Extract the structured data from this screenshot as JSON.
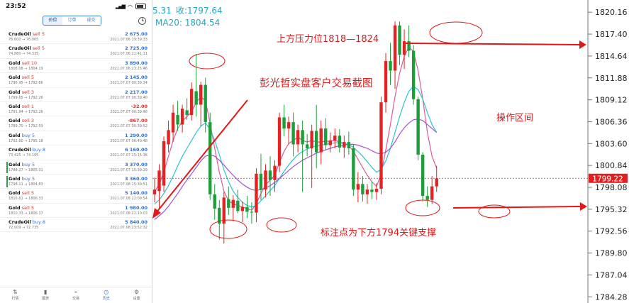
{
  "phone": {
    "status_time": "23:52",
    "tabs": [
      "价位",
      "订单",
      "成交"
    ],
    "active_tab": 0,
    "trades": [
      {
        "symbol": "CrudeOil",
        "side": "sell",
        "lots": "5",
        "profit": "2 675.00",
        "prices": "76.600 → 76.065",
        "time": "2021.07.06 19:39:33"
      },
      {
        "symbol": "CrudeOil",
        "side": "sell",
        "lots": "5",
        "profit": "2 725.00",
        "prices": "74.880 → 74.335",
        "time": "2021.07.06 21:41:11"
      },
      {
        "symbol": "Gold",
        "side": "sell",
        "lots": "10",
        "profit": "3 890.00",
        "prices": "1808.08 → 1804.19",
        "time": "2021.07.06 23:25:46"
      },
      {
        "symbol": "Gold",
        "side": "sell",
        "lots": "5",
        "profit": "2 145.00",
        "prices": "1796.95 → 1792.66",
        "time": "2021.07.07 00:39:34"
      },
      {
        "symbol": "Gold",
        "side": "sell",
        "lots": "3",
        "profit": "2 217.00",
        "prices": "1799.65 → 1792.26",
        "time": "2021.07.07 00:39:40"
      },
      {
        "symbol": "Gold",
        "side": "sell",
        "lots": "1",
        "profit": "-32.00",
        "prices": "1791.94 → 1792.26",
        "time": "2021.07.07 00:39:46"
      },
      {
        "symbol": "Gold",
        "side": "sell",
        "lots": "3",
        "profit": "-867.00",
        "prices": "1789.70 → 1792.59",
        "time": "2021.07.07 00:39:52"
      },
      {
        "symbol": "Gold",
        "side": "buy",
        "lots": "5",
        "profit": "1 290.00",
        "prices": "1792.60 → 1795.18",
        "time": "2021.07.07 06:40:48"
      },
      {
        "symbol": "CrudeOil",
        "side": "buy",
        "lots": "8",
        "profit": "6 160.00",
        "prices": "73.425 → 74.195",
        "time": "2021.07.07 15:15:36"
      },
      {
        "symbol": "Gold",
        "side": "buy",
        "lots": "5",
        "profit": "3 370.00",
        "prices": "1798.27 → 1805.01",
        "time": "2021.07.07 15:39:29"
      },
      {
        "symbol": "Gold",
        "side": "buy",
        "lots": "5",
        "profit": "3 360.00",
        "prices": "1798.11 → 1804.83",
        "time": "2021.07.08 15:30:51"
      },
      {
        "symbol": "Gold",
        "side": "sell",
        "lots": "5",
        "profit": "5 140.00",
        "prices": "1816.61 → 1806.33",
        "time": "2021.07.08 22:09:54"
      },
      {
        "symbol": "Gold",
        "side": "sell",
        "lots": "5",
        "profit": "1 980.00",
        "prices": "1810.33 → 1806.37",
        "time": "2021.07.08 22:10:03"
      },
      {
        "symbol": "CrudeOil",
        "side": "buy",
        "lots": "8",
        "profit": "5 840.00",
        "prices": "72.009 → 72.735",
        "time": "2021.07.08 23:52:32"
      }
    ],
    "nav": [
      "行情",
      "图表",
      "交易",
      "历史",
      "设置"
    ],
    "active_nav": 3
  },
  "header": {
    "close_prefix": "5.31",
    "close_label": "收:1797.64",
    "ma20_label": "MA20: 1804.54"
  },
  "annotations": {
    "watermark": "彭光哲实盘客户交易截图",
    "resistance": "上方压力位1818—1824",
    "operate": "操作区间",
    "support": "标注点为下方1794关键支撑"
  },
  "current_price": "1799.22",
  "colors": {
    "up": "#e32222",
    "down": "#1e9e3a",
    "ma_short": "#e05a9a",
    "ma_mid": "#28c4d2",
    "ma_long": "#a64fd0",
    "annotation": "#e01818",
    "price_tag": "#e02020",
    "header_text": "#22a8c8"
  },
  "chart_data": {
    "type": "candlestick",
    "ylim": [
      1783.5,
      1821.7
    ],
    "yticks": [
      1820.16,
      1817.4,
      1814.64,
      1811.88,
      1809.12,
      1806.36,
      1803.6,
      1800.84,
      1798.08,
      1795.32,
      1792.56,
      1789.8,
      1787.04,
      1784.28
    ],
    "candles": [
      {
        "o": 1797.2,
        "h": 1799.3,
        "l": 1796.2,
        "c": 1797.8
      },
      {
        "o": 1797.6,
        "h": 1801.0,
        "l": 1795.5,
        "c": 1800.2
      },
      {
        "o": 1798.3,
        "h": 1804.5,
        "l": 1797.5,
        "c": 1803.9
      },
      {
        "o": 1803.5,
        "h": 1806.5,
        "l": 1802.5,
        "c": 1805.3
      },
      {
        "o": 1805.0,
        "h": 1808.5,
        "l": 1803.8,
        "c": 1807.5
      },
      {
        "o": 1807.2,
        "h": 1809.0,
        "l": 1805.2,
        "c": 1806.0
      },
      {
        "o": 1806.0,
        "h": 1808.5,
        "l": 1805.0,
        "c": 1808.0
      },
      {
        "o": 1807.8,
        "h": 1809.3,
        "l": 1806.6,
        "c": 1807.2
      },
      {
        "o": 1807.2,
        "h": 1811.3,
        "l": 1806.5,
        "c": 1810.5
      },
      {
        "o": 1810.2,
        "h": 1814.9,
        "l": 1807.0,
        "c": 1808.5
      },
      {
        "o": 1808.5,
        "h": 1811.4,
        "l": 1805.8,
        "c": 1811.0
      },
      {
        "o": 1811.0,
        "h": 1811.9,
        "l": 1805.0,
        "c": 1806.3
      },
      {
        "o": 1806.3,
        "h": 1807.5,
        "l": 1796.5,
        "c": 1797.2
      },
      {
        "o": 1797.2,
        "h": 1798.5,
        "l": 1794.0,
        "c": 1795.4
      },
      {
        "o": 1795.5,
        "h": 1796.5,
        "l": 1791.5,
        "c": 1793.5
      },
      {
        "o": 1793.5,
        "h": 1797.5,
        "l": 1791.0,
        "c": 1796.8
      },
      {
        "o": 1796.6,
        "h": 1798.2,
        "l": 1794.6,
        "c": 1795.5
      },
      {
        "o": 1795.5,
        "h": 1797.1,
        "l": 1793.8,
        "c": 1796.5
      },
      {
        "o": 1796.4,
        "h": 1797.8,
        "l": 1794.8,
        "c": 1795.1
      },
      {
        "o": 1795.1,
        "h": 1796.3,
        "l": 1793.7,
        "c": 1795.6
      },
      {
        "o": 1795.6,
        "h": 1797.0,
        "l": 1794.2,
        "c": 1795.0
      },
      {
        "o": 1795.0,
        "h": 1796.2,
        "l": 1793.5,
        "c": 1794.9
      },
      {
        "o": 1794.9,
        "h": 1800.5,
        "l": 1793.7,
        "c": 1799.8
      },
      {
        "o": 1799.8,
        "h": 1802.3,
        "l": 1796.5,
        "c": 1797.8
      },
      {
        "o": 1797.8,
        "h": 1801.0,
        "l": 1796.8,
        "c": 1800.2
      },
      {
        "o": 1800.2,
        "h": 1802.0,
        "l": 1797.0,
        "c": 1799.0
      },
      {
        "o": 1799.0,
        "h": 1801.5,
        "l": 1797.5,
        "c": 1800.8
      },
      {
        "o": 1800.8,
        "h": 1807.5,
        "l": 1800.0,
        "c": 1806.9
      },
      {
        "o": 1806.9,
        "h": 1808.5,
        "l": 1804.5,
        "c": 1805.5
      },
      {
        "o": 1805.5,
        "h": 1807.0,
        "l": 1803.5,
        "c": 1806.3
      },
      {
        "o": 1806.3,
        "h": 1807.5,
        "l": 1802.0,
        "c": 1803.5
      },
      {
        "o": 1803.5,
        "h": 1806.0,
        "l": 1802.5,
        "c": 1805.3
      },
      {
        "o": 1805.3,
        "h": 1806.5,
        "l": 1797.5,
        "c": 1803.5
      },
      {
        "o": 1803.5,
        "h": 1804.8,
        "l": 1802.0,
        "c": 1803.0
      },
      {
        "o": 1803.0,
        "h": 1806.0,
        "l": 1798.0,
        "c": 1805.2
      },
      {
        "o": 1805.2,
        "h": 1808.5,
        "l": 1800.5,
        "c": 1802.5
      },
      {
        "o": 1802.5,
        "h": 1806.5,
        "l": 1801.0,
        "c": 1805.5
      },
      {
        "o": 1805.5,
        "h": 1806.8,
        "l": 1802.8,
        "c": 1803.4
      },
      {
        "o": 1803.4,
        "h": 1805.0,
        "l": 1802.5,
        "c": 1804.0
      },
      {
        "o": 1804.0,
        "h": 1805.5,
        "l": 1803.0,
        "c": 1804.6
      },
      {
        "o": 1804.6,
        "h": 1805.4,
        "l": 1802.5,
        "c": 1803.1
      },
      {
        "o": 1803.1,
        "h": 1804.6,
        "l": 1801.8,
        "c": 1803.8
      },
      {
        "o": 1803.8,
        "h": 1805.1,
        "l": 1802.2,
        "c": 1803.0
      },
      {
        "o": 1803.0,
        "h": 1803.5,
        "l": 1797.0,
        "c": 1797.8
      },
      {
        "o": 1797.8,
        "h": 1800.0,
        "l": 1796.2,
        "c": 1798.5
      },
      {
        "o": 1798.5,
        "h": 1799.5,
        "l": 1796.3,
        "c": 1797.2
      },
      {
        "o": 1797.2,
        "h": 1798.5,
        "l": 1796.0,
        "c": 1797.8
      },
      {
        "o": 1797.8,
        "h": 1798.8,
        "l": 1796.6,
        "c": 1797.5
      },
      {
        "o": 1797.5,
        "h": 1798.6,
        "l": 1796.5,
        "c": 1797.9
      },
      {
        "o": 1797.9,
        "h": 1809.5,
        "l": 1797.2,
        "c": 1808.8
      },
      {
        "o": 1808.8,
        "h": 1815.0,
        "l": 1807.5,
        "c": 1814.0
      },
      {
        "o": 1814.0,
        "h": 1816.3,
        "l": 1811.0,
        "c": 1812.8
      },
      {
        "o": 1812.8,
        "h": 1819.0,
        "l": 1810.5,
        "c": 1818.5
      },
      {
        "o": 1818.5,
        "h": 1819.0,
        "l": 1813.5,
        "c": 1814.8
      },
      {
        "o": 1814.8,
        "h": 1818.0,
        "l": 1813.0,
        "c": 1816.5
      },
      {
        "o": 1816.5,
        "h": 1818.5,
        "l": 1814.5,
        "c": 1815.3
      },
      {
        "o": 1815.3,
        "h": 1816.0,
        "l": 1808.5,
        "c": 1809.2
      },
      {
        "o": 1809.2,
        "h": 1809.5,
        "l": 1801.5,
        "c": 1802.2
      },
      {
        "o": 1802.2,
        "h": 1802.5,
        "l": 1796.3,
        "c": 1797.0
      },
      {
        "o": 1797.0,
        "h": 1798.2,
        "l": 1795.6,
        "c": 1796.5
      },
      {
        "o": 1796.5,
        "h": 1799.5,
        "l": 1796.0,
        "c": 1798.2
      },
      {
        "o": 1798.2,
        "h": 1800.8,
        "l": 1797.5,
        "c": 1799.2
      }
    ],
    "series": [
      {
        "values": [
          1797.5,
          1798.5,
          1800.0,
          1802.0,
          1804.0,
          1805.5,
          1806.4,
          1807.0,
          1807.6,
          1808.8,
          1809.5,
          1809.0,
          1806.2,
          1803.0,
          1800.0,
          1797.6,
          1796.4,
          1796.0,
          1795.8,
          1795.6,
          1795.4,
          1795.2,
          1796.0,
          1797.3,
          1798.4,
          1799.0,
          1799.6,
          1801.2,
          1802.6,
          1803.6,
          1804.0,
          1804.4,
          1804.0,
          1803.8,
          1804.0,
          1803.8,
          1803.8,
          1803.9,
          1803.9,
          1804.0,
          1803.8,
          1803.6,
          1803.4,
          1802.6,
          1801.6,
          1800.6,
          1799.6,
          1798.8,
          1798.2,
          1799.8,
          1802.8,
          1806.0,
          1809.5,
          1812.5,
          1814.6,
          1815.8,
          1815.2,
          1812.8,
          1809.2,
          1805.0,
          1802.0,
          1800.5
        ]
      },
      {
        "values": [
          1796.0,
          1796.5,
          1797.3,
          1798.3,
          1799.5,
          1800.8,
          1802.0,
          1803.0,
          1804.0,
          1805.0,
          1805.8,
          1806.2,
          1805.4,
          1804.0,
          1802.2,
          1800.3,
          1798.8,
          1797.6,
          1796.8,
          1796.2,
          1795.8,
          1795.6,
          1795.8,
          1796.4,
          1797.0,
          1797.7,
          1798.3,
          1799.2,
          1800.1,
          1800.9,
          1801.6,
          1802.2,
          1802.6,
          1802.9,
          1803.2,
          1803.3,
          1803.4,
          1803.5,
          1803.6,
          1803.7,
          1803.7,
          1803.6,
          1803.5,
          1803.1,
          1802.6,
          1802.0,
          1801.3,
          1800.6,
          1800.0,
          1800.3,
          1801.4,
          1803.0,
          1805.0,
          1807.0,
          1808.8,
          1810.2,
          1810.8,
          1810.4,
          1809.2,
          1807.5,
          1806.0,
          1805.0
        ]
      },
      {
        "values": [
          1794.0,
          1794.5,
          1795.0,
          1795.7,
          1796.5,
          1797.3,
          1798.2,
          1799.0,
          1799.8,
          1800.6,
          1801.4,
          1802.0,
          1802.2,
          1802.0,
          1801.5,
          1800.9,
          1800.2,
          1799.6,
          1799.0,
          1798.5,
          1798.1,
          1797.8,
          1797.7,
          1797.8,
          1798.0,
          1798.3,
          1798.7,
          1799.2,
          1799.7,
          1800.2,
          1800.7,
          1801.1,
          1801.5,
          1801.8,
          1802.1,
          1802.4,
          1802.6,
          1802.8,
          1803.0,
          1803.2,
          1803.3,
          1803.4,
          1803.5,
          1803.5,
          1803.4,
          1803.2,
          1803.0,
          1802.7,
          1802.4,
          1802.3,
          1802.5,
          1803.0,
          1803.8,
          1804.8,
          1805.6,
          1806.2,
          1806.6,
          1806.7,
          1806.5,
          1806.0,
          1805.5,
          1805.0
        ]
      }
    ]
  }
}
